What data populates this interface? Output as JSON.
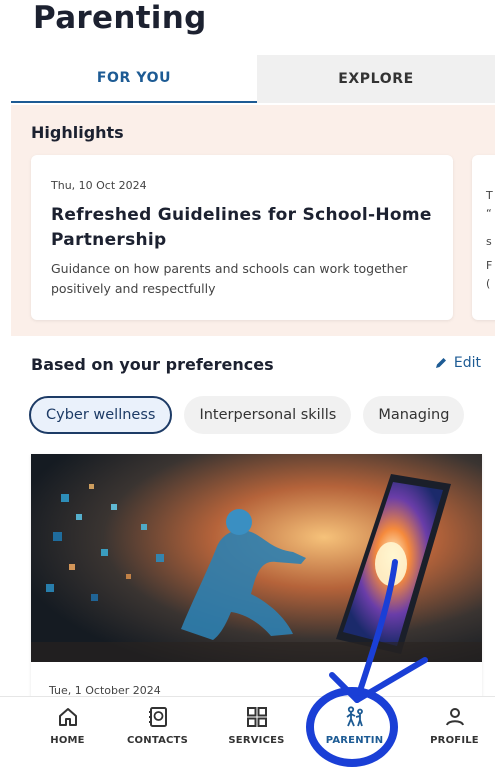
{
  "page": {
    "title": "Parenting"
  },
  "tabs": [
    {
      "label": "FOR YOU",
      "active": true
    },
    {
      "label": "EXPLORE",
      "active": false
    }
  ],
  "highlights": {
    "heading": "Highlights",
    "cards": [
      {
        "date": "Thu, 10 Oct 2024",
        "title": "Refreshed Guidelines for School-Home Partnership",
        "description": "Guidance on how parents and schools can work together positively and respectfully"
      }
    ],
    "peek_letters": [
      "T",
      "“",
      "s",
      "F",
      "("
    ]
  },
  "preferences": {
    "heading": "Based on your preferences",
    "edit_label": "Edit",
    "chips": [
      {
        "label": "Cyber wellness",
        "selected": true
      },
      {
        "label": "Interpersonal skills",
        "selected": false
      },
      {
        "label": "Managing",
        "selected": false
      }
    ]
  },
  "article": {
    "date": "Tue, 1 October 2024",
    "image_icon": "tablet-digital-figure-illustration"
  },
  "bottom_nav": [
    {
      "label": "HOME",
      "icon": "home-icon"
    },
    {
      "label": "CONTACTS",
      "icon": "contacts-icon"
    },
    {
      "label": "SERVICES",
      "icon": "grid-icon"
    },
    {
      "label": "PARENTIN",
      "icon": "parenting-icon",
      "active": true
    },
    {
      "label": "PROFILE",
      "icon": "person-icon"
    }
  ],
  "colors": {
    "accent": "#1d5b94",
    "highlight_bg": "#fbefe9",
    "annotation": "#1a3fd6"
  }
}
